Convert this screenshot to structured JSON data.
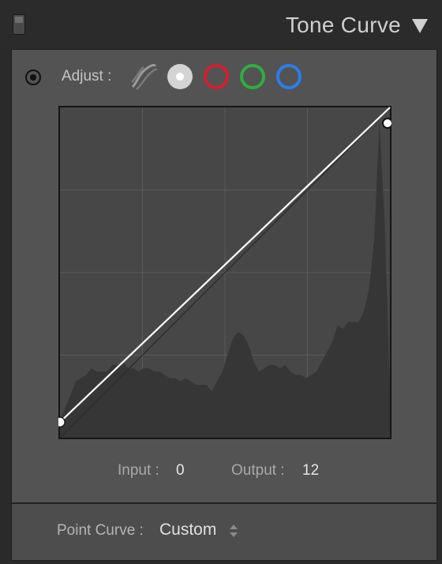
{
  "panel": {
    "title": "Tone Curve",
    "icons": {
      "switch": "panel-toggle-icon",
      "collapse": "collapse-triangle-icon"
    }
  },
  "adjust": {
    "label": "Adjust :",
    "targeted_adjustment_icon": "target-icon",
    "channels": [
      {
        "name": "parametric",
        "icon": "parametric-curve-icon"
      },
      {
        "name": "point-rgb",
        "icon": "point-curve-rgb-icon",
        "selected": true,
        "color": "#d4d4d4"
      },
      {
        "name": "red",
        "icon": "red-channel-icon",
        "color": "#d1202e"
      },
      {
        "name": "green",
        "icon": "green-channel-icon",
        "color": "#2fae3f"
      },
      {
        "name": "blue",
        "icon": "blue-channel-icon",
        "color": "#2a7ee8"
      }
    ]
  },
  "readout": {
    "input_label": "Input :",
    "input_value": "0",
    "output_label": "Output :",
    "output_value": "12"
  },
  "point_curve": {
    "label": "Point Curve :",
    "value": "Custom"
  },
  "curve": {
    "points": [
      {
        "input": 0,
        "output": 12
      },
      {
        "input": 255,
        "output": 255
      }
    ],
    "histogram": [
      5,
      9,
      13,
      17,
      18,
      19,
      21,
      20,
      20,
      20,
      22,
      22,
      23,
      21,
      21,
      20,
      21,
      21,
      20,
      20,
      19,
      18,
      18,
      17,
      18,
      17,
      16,
      16,
      16,
      14,
      17,
      20,
      25,
      30,
      32,
      31,
      28,
      23,
      20,
      21,
      22,
      22,
      21,
      22,
      20,
      19,
      19,
      18,
      19,
      20,
      23,
      26,
      29,
      34,
      33,
      35,
      35,
      35,
      38,
      45,
      60,
      96,
      65,
      15
    ],
    "colors": {
      "background": "#474747",
      "grid": "#5a5a5a",
      "histogram": "#363636",
      "curve": "#ffffff",
      "point": "#ffffff"
    }
  }
}
